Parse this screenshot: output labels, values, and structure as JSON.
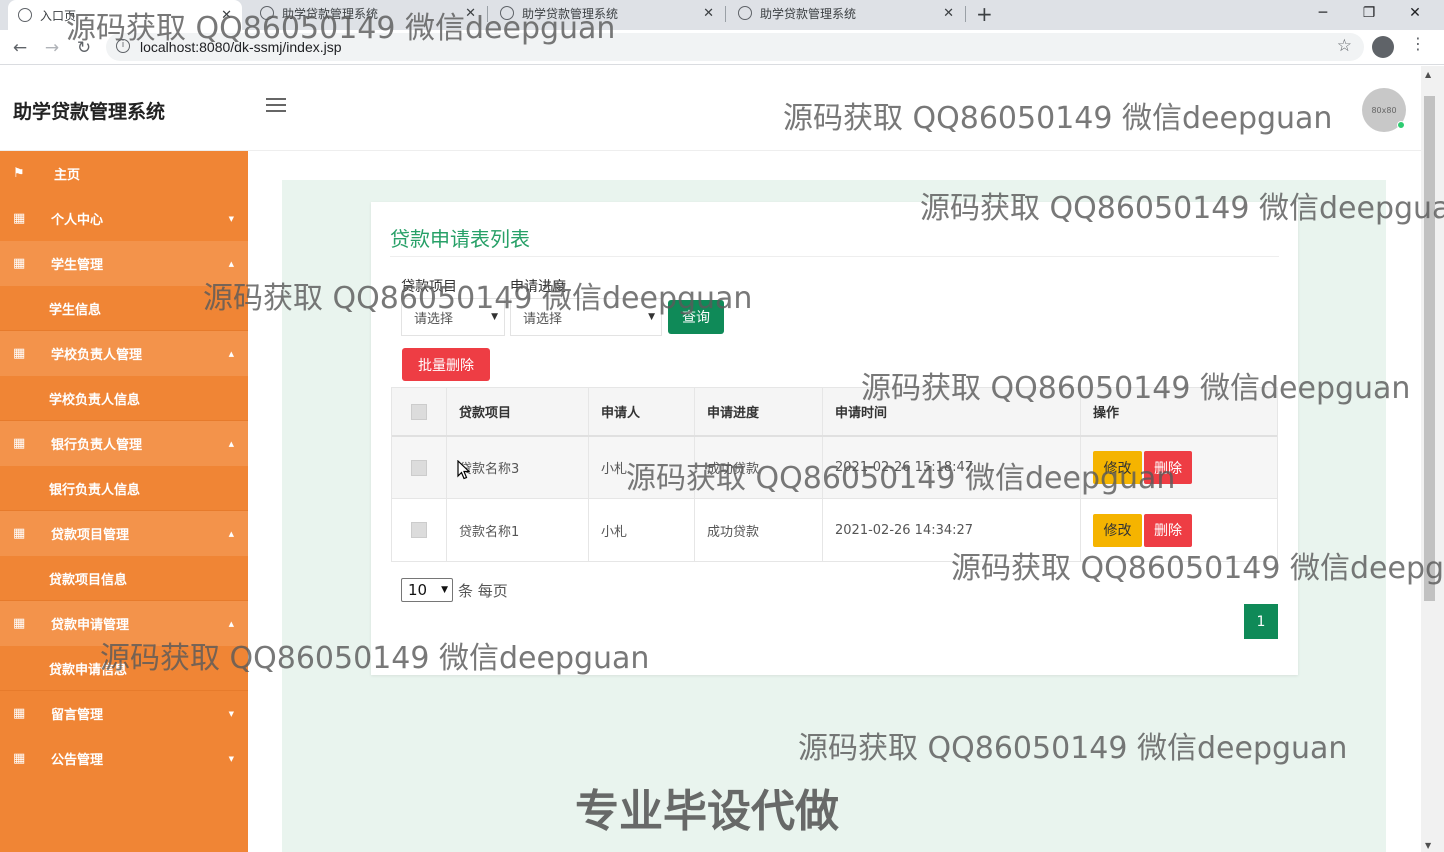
{
  "browser": {
    "tabs": [
      {
        "title": "入口页"
      },
      {
        "title": "助学贷款管理系统"
      },
      {
        "title": "助学贷款管理系统"
      },
      {
        "title": "助学贷款管理系统"
      }
    ],
    "url": "localhost:8080/dk-ssmj/index.jsp",
    "icons": {
      "back": "back-arrow-icon",
      "forward": "forward-arrow-icon",
      "reload": "reload-icon",
      "bookmark": "star-icon"
    }
  },
  "header": {
    "brand": "助学贷款管理系统",
    "avatar_text": "80x80"
  },
  "sidebar": {
    "items": [
      {
        "label": "主页",
        "icon": "flag-icon"
      },
      {
        "label": "个人中心",
        "icon": "grid-icon"
      },
      {
        "label": "学生管理",
        "icon": "grid-icon",
        "open": true,
        "sub": "学生信息"
      },
      {
        "label": "学校负责人管理",
        "icon": "grid-icon",
        "open": true,
        "sub": "学校负责人信息"
      },
      {
        "label": "银行负责人管理",
        "icon": "grid-icon",
        "open": true,
        "sub": "银行负责人信息"
      },
      {
        "label": "贷款项目管理",
        "icon": "grid-icon",
        "open": true,
        "sub": "贷款项目信息"
      },
      {
        "label": "贷款申请管理",
        "icon": "grid-icon",
        "open": true,
        "sub": "贷款申请信息"
      },
      {
        "label": "留言管理",
        "icon": "grid-icon"
      },
      {
        "label": "公告管理",
        "icon": "grid-icon"
      }
    ]
  },
  "content": {
    "title": "贷款申请表列表",
    "filters": {
      "project_label": "贷款项目",
      "project_value": "请选择",
      "progress_label": "申请进度",
      "progress_value": "请选择",
      "search_button": "查询"
    },
    "batch_delete": "批量删除",
    "table": {
      "headers": [
        "贷款项目",
        "申请人",
        "申请进度",
        "申请时间",
        "操作"
      ],
      "rows": [
        {
          "project": "贷款名称3",
          "applicant": "小札",
          "progress": "成功贷款",
          "time": "2021-02-26 15:18:47"
        },
        {
          "project": "贷款名称1",
          "applicant": "小札",
          "progress": "成功贷款",
          "time": "2021-02-26 14:34:27"
        }
      ],
      "edit_label": "修改",
      "delete_label": "删除"
    },
    "pagination": {
      "page_size": "10",
      "page_size_label": "条 每页",
      "current_page": "1"
    }
  },
  "watermarks": {
    "text": "源码获取 QQ86050149 微信deepguan",
    "text_cut_1": "源码获取 QQ86050149 微信deepgua",
    "text_cut_2": "源码获取 QQ86050149 微信deepgu",
    "banner": "专业毕设代做"
  }
}
